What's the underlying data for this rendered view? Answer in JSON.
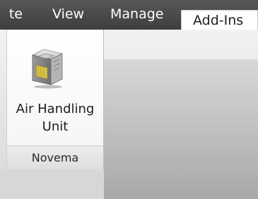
{
  "tabs": [
    {
      "label": "te"
    },
    {
      "label": "View"
    },
    {
      "label": "Manage"
    },
    {
      "label": "Add-Ins",
      "active": true
    }
  ],
  "ribbon": {
    "group": {
      "label": "Novema",
      "button": {
        "label_line1": "Air Handling",
        "label_line2": "Unit",
        "icon": "air-handling-unit-icon"
      }
    }
  }
}
